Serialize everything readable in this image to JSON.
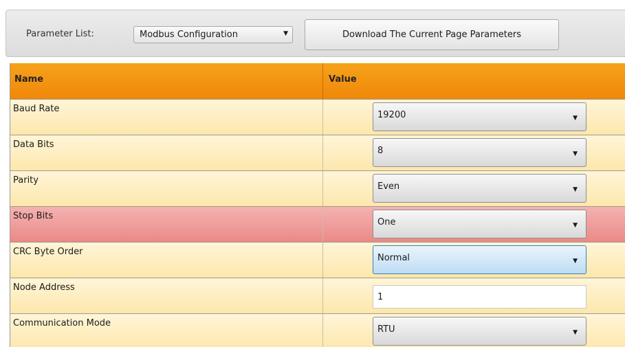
{
  "toolbar": {
    "parameter_list_label": "Parameter List:",
    "parameter_list_selected": "Modbus Configuration",
    "download_button_label": "Download The Current Page Parameters",
    "dropdown_icon": "triangle-down"
  },
  "grid": {
    "columns": {
      "name": "Name",
      "value": "Value"
    },
    "rows": [
      {
        "name": "Baud Rate",
        "value": "19200",
        "editor": "combo"
      },
      {
        "name": "Data Bits",
        "value": "8",
        "editor": "combo"
      },
      {
        "name": "Parity",
        "value": "Even",
        "editor": "combo"
      },
      {
        "name": "Stop Bits",
        "value": "One",
        "editor": "combo",
        "highlighted": true
      },
      {
        "name": "CRC Byte Order",
        "value": "Normal",
        "editor": "combo",
        "focused": true
      },
      {
        "name": "Node Address",
        "value": "1",
        "editor": "text"
      },
      {
        "name": "Communication Mode",
        "value": "RTU",
        "editor": "combo"
      }
    ]
  },
  "colors": {
    "header_orange": "#f3930f",
    "row_yellow": "#fdeab4",
    "row_highlight_red": "#ee9c9a",
    "focus_blue": "#bddcf3"
  }
}
